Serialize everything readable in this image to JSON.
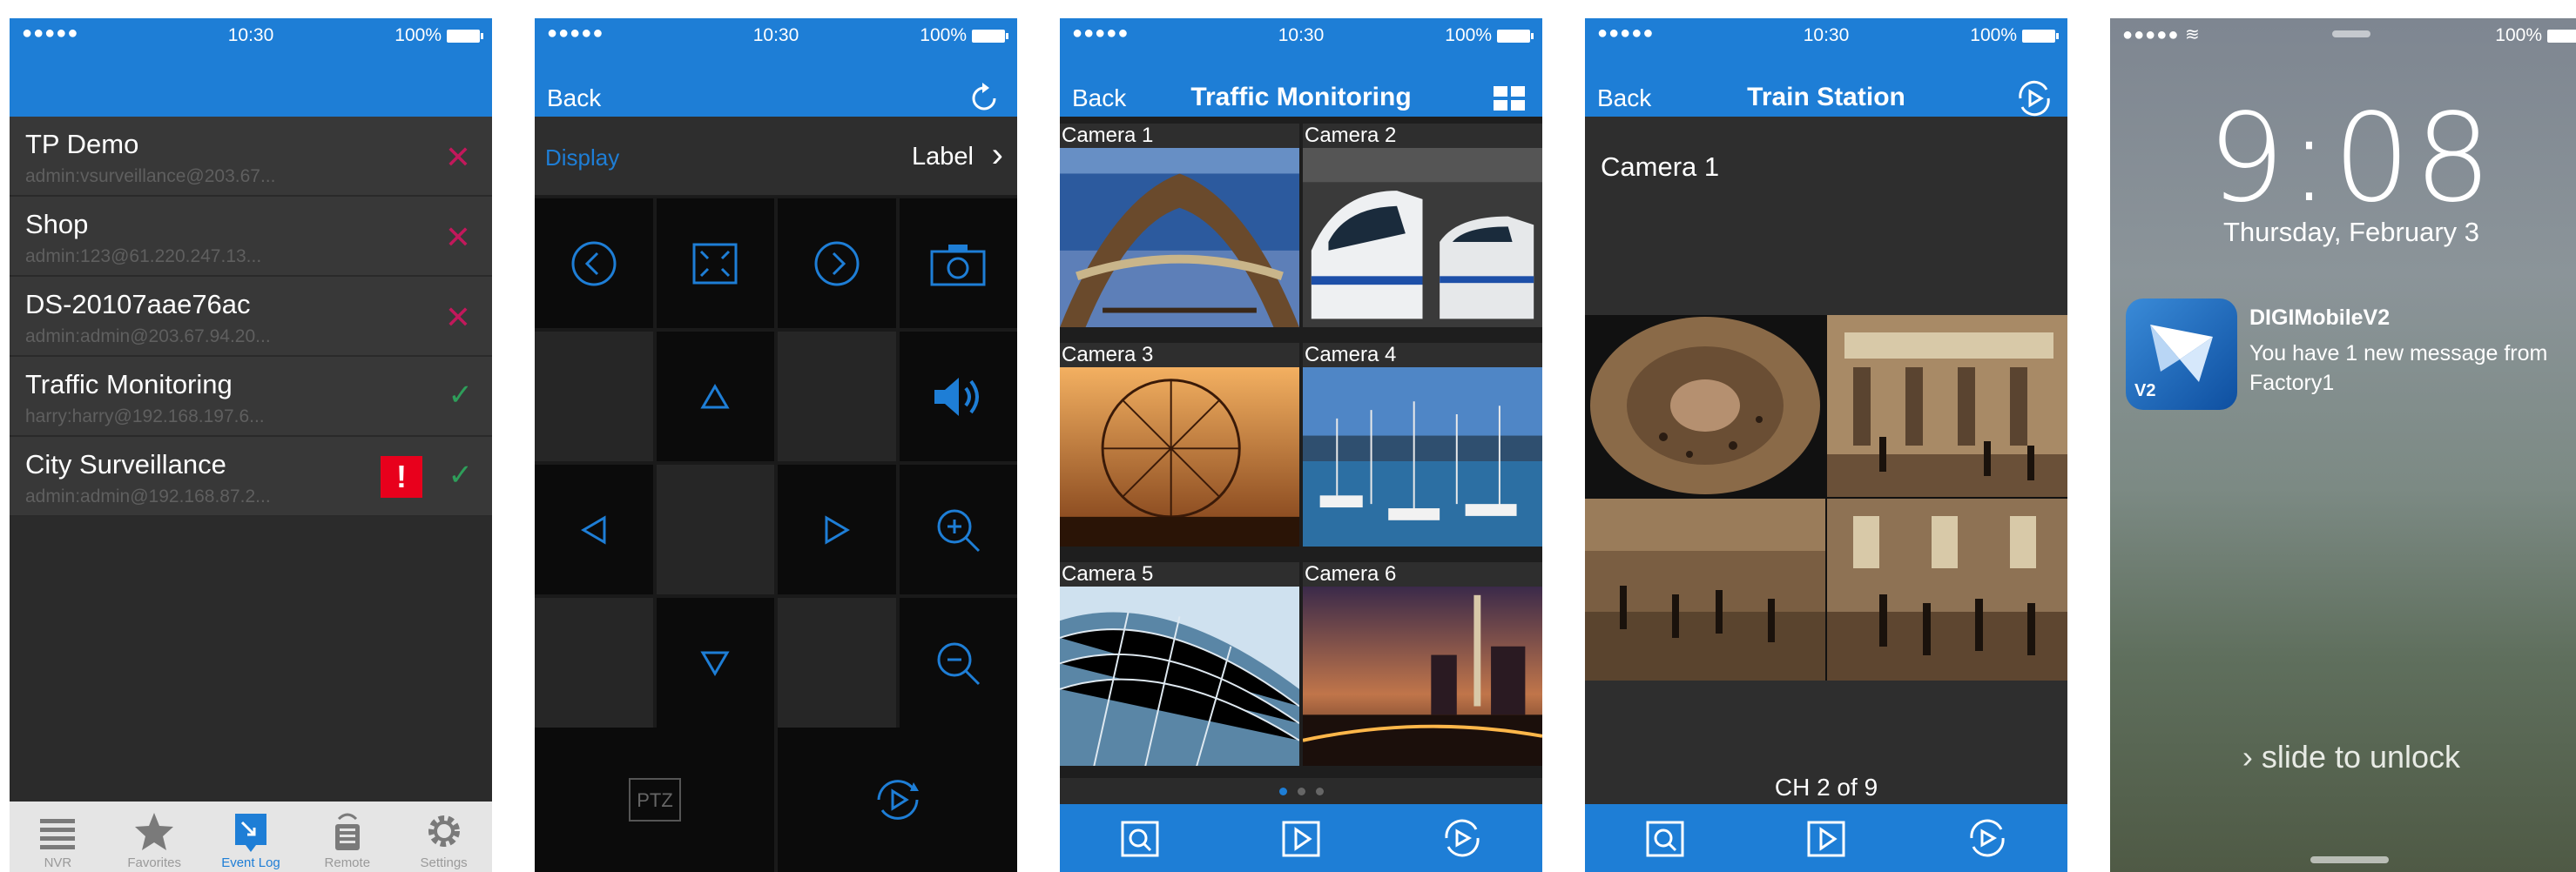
{
  "status": {
    "signal": "●●●●●",
    "time": "10:30",
    "battery": "100%"
  },
  "screen_nvr": {
    "devices": [
      {
        "name": "TP Demo",
        "address": "admin:vsurveillance@203.67...",
        "state": "remove"
      },
      {
        "name": "Shop",
        "address": "admin:123@61.220.247.13...",
        "state": "remove"
      },
      {
        "name": "DS-20107aae76ac",
        "address": "admin:admin@203.67.94.20...",
        "state": "remove"
      },
      {
        "name": "Traffic Monitoring",
        "address": "harry:harry@192.168.197.6...",
        "state": "connected"
      },
      {
        "name": "City Surveillance",
        "address": "admin:admin@192.168.87.2...",
        "state": "connected",
        "alert": "!"
      }
    ],
    "tabs": [
      {
        "label": "NVR",
        "icon": "list-icon"
      },
      {
        "label": "Favorites",
        "icon": "star-icon"
      },
      {
        "label": "Event Log",
        "icon": "event-log-icon",
        "active": true
      },
      {
        "label": "Remote",
        "icon": "remote-icon"
      },
      {
        "label": "Settings",
        "icon": "gear-icon"
      }
    ],
    "remove_glyph": "✕",
    "check_glyph": "✓"
  },
  "screen_ptz": {
    "back": "Back",
    "display_label": "Display",
    "display_value": "Label",
    "ptz_label": "PTZ"
  },
  "screen_grid": {
    "back": "Back",
    "title": "Traffic Monitoring",
    "cameras": [
      "Camera 1",
      "Camera 2",
      "Camera 3",
      "Camera 4",
      "Camera 5",
      "Camera 6"
    ],
    "page_count": 3,
    "page_active": 0
  },
  "screen_single": {
    "back": "Back",
    "title": "Train Station",
    "camera": "Camera 1",
    "channel": "CH 2 of 9"
  },
  "screen_lock": {
    "signal": "●●●●● ≋",
    "battery": "100%",
    "time": "9:08",
    "date": "Thursday, February 3",
    "app_name": "DIGIMobileV2",
    "app_badge": "V2",
    "message": "You have 1 new message from Factory1",
    "slide": "slide to unlock"
  },
  "colors": {
    "accent": "#1e7ed6",
    "remove": "#c2185b",
    "connected": "#2e9e5a",
    "alert": "#e8001c"
  }
}
